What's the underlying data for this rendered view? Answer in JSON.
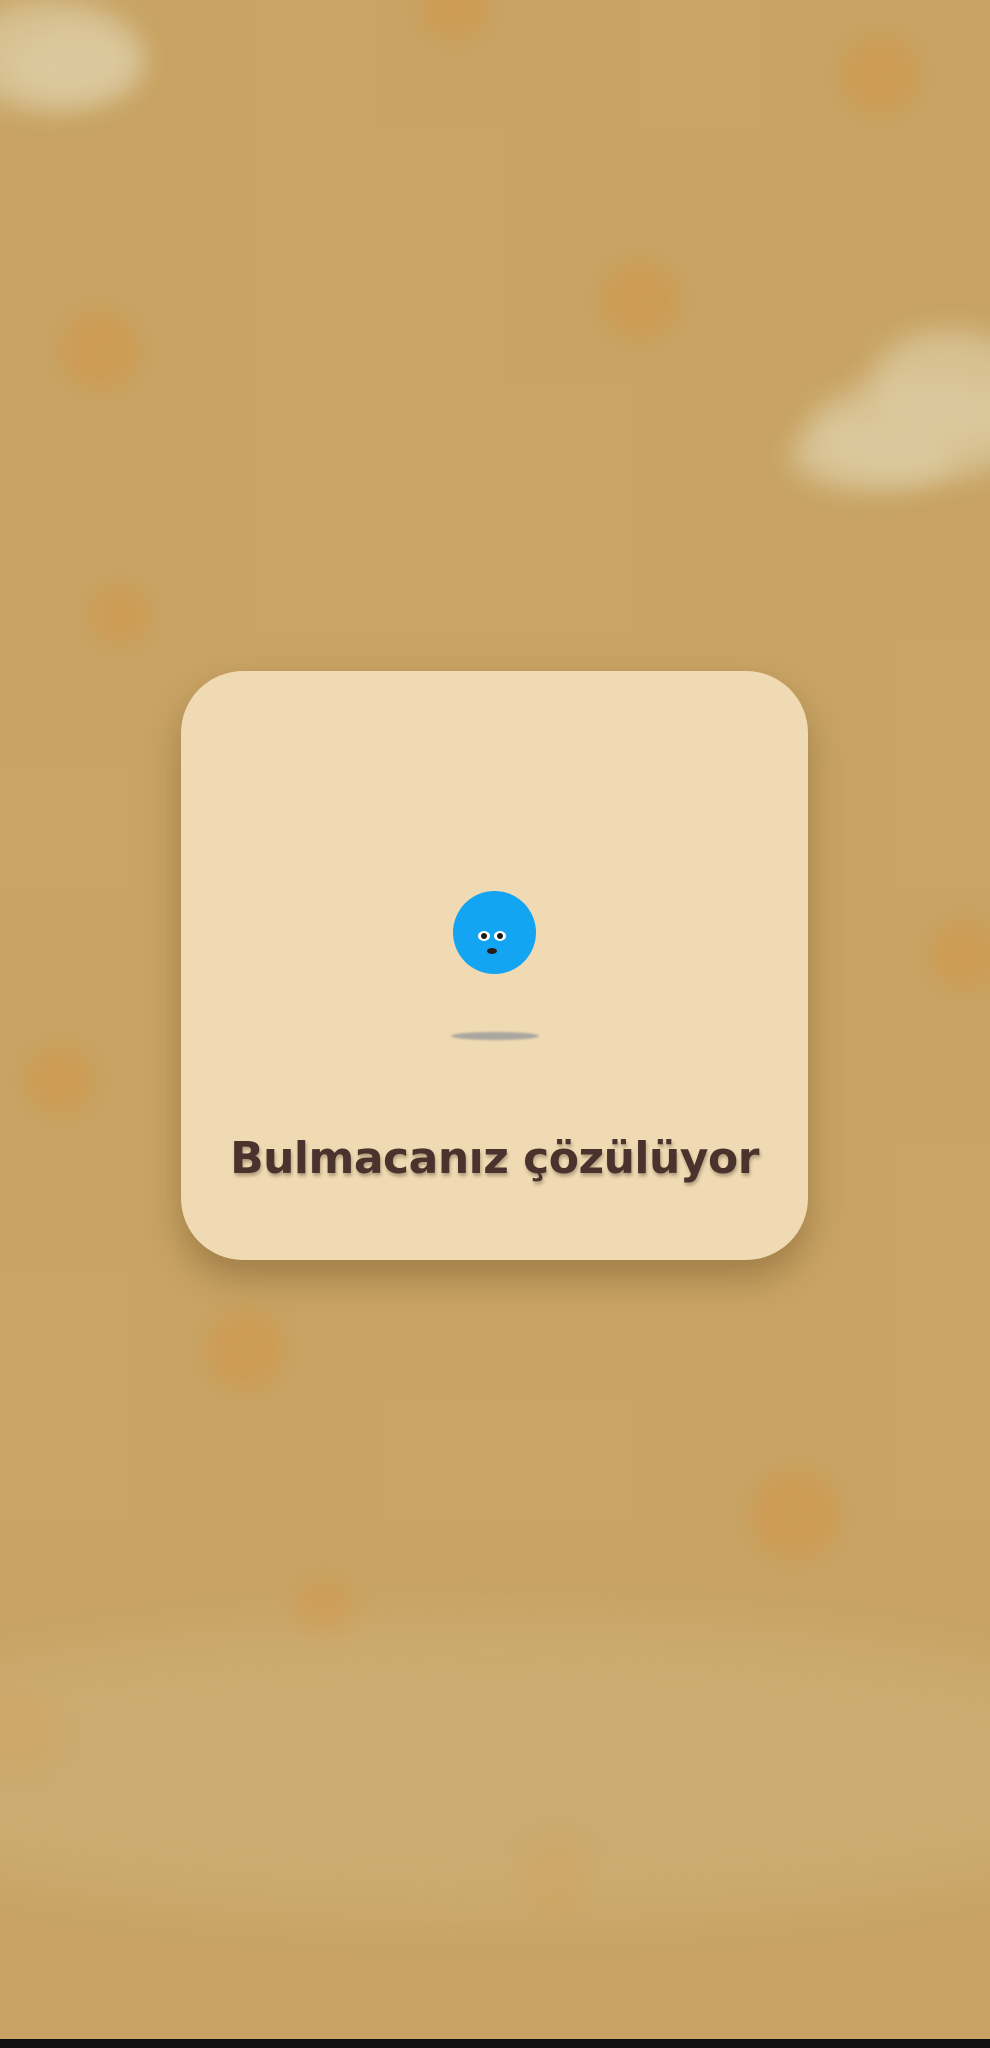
{
  "loading_dialog": {
    "message": "Bulmacanız çözülüyor",
    "mascot_icon": "blue-ball-face-icon",
    "accent_color": "#13A4F2",
    "card_color": "#F0DAB3",
    "text_color": "#4A322D"
  },
  "background": {
    "color": "#CDA766"
  }
}
